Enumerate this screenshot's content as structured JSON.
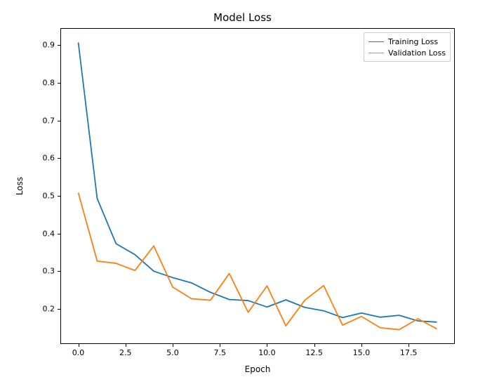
{
  "chart_data": {
    "type": "line",
    "title": "Model Loss",
    "xlabel": "Epoch",
    "ylabel": "Loss",
    "x": [
      0,
      1,
      2,
      3,
      4,
      5,
      6,
      7,
      8,
      9,
      10,
      11,
      12,
      13,
      14,
      15,
      16,
      17,
      18,
      19
    ],
    "series": [
      {
        "name": "Training Loss",
        "color": "#1f77b4",
        "values": [
          0.907,
          0.493,
          0.373,
          0.344,
          0.3,
          0.283,
          0.269,
          0.244,
          0.225,
          0.222,
          0.205,
          0.224,
          0.204,
          0.195,
          0.177,
          0.189,
          0.178,
          0.183,
          0.168,
          0.165
        ]
      },
      {
        "name": "Validation Loss",
        "color": "#ff7f0e",
        "values": [
          0.508,
          0.327,
          0.321,
          0.302,
          0.367,
          0.258,
          0.227,
          0.223,
          0.294,
          0.191,
          0.261,
          0.155,
          0.223,
          0.262,
          0.157,
          0.18,
          0.15,
          0.145,
          0.174,
          0.147
        ]
      }
    ],
    "xlim": [
      -0.95,
      19.95
    ],
    "ylim": [
      0.1069,
      0.9451
    ],
    "xticks": [
      0.0,
      2.5,
      5.0,
      7.5,
      10.0,
      12.5,
      15.0,
      17.5
    ],
    "xtick_labels": [
      "0.0",
      "2.5",
      "5.0",
      "7.5",
      "10.0",
      "12.5",
      "15.0",
      "17.5"
    ],
    "yticks": [
      0.2,
      0.3,
      0.4,
      0.5,
      0.6,
      0.7,
      0.8,
      0.9
    ],
    "ytick_labels": [
      "0.2",
      "0.3",
      "0.4",
      "0.5",
      "0.6",
      "0.7",
      "0.8",
      "0.9"
    ],
    "legend_position": "upper right",
    "grid": false
  }
}
